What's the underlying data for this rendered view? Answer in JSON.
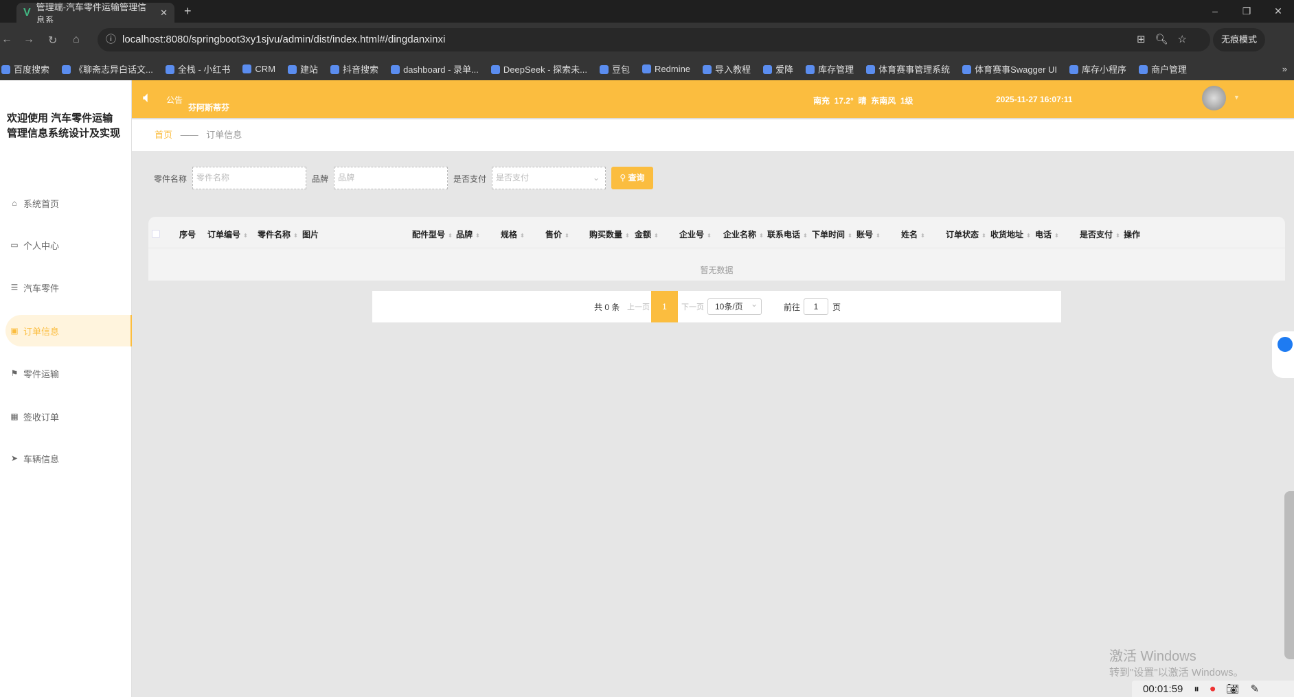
{
  "browser": {
    "tab_title": "管理端-汽车零件运输管理信息系",
    "url": "localhost:8080/springboot3xy1sjvu/admin/dist/index.html#/dingdanxinxi",
    "incognito": "无痕模式",
    "bookmarks": [
      "百度搜索",
      "《聊斋志异白话文...",
      "全栈 - 小红书",
      "CRM",
      "建站",
      "抖音搜索",
      "dashboard - 录单...",
      "DeepSeek - 探索未...",
      "豆包",
      "Redmine",
      "导入教程",
      "爱降",
      "库存管理",
      "体育赛事管理系统",
      "体育赛事Swagger UI",
      "库存小程序",
      "商户管理"
    ]
  },
  "sidebar": {
    "title": "欢迎使用 汽车零件运输管理信息系统设计及实现",
    "items": [
      {
        "label": "系统首页",
        "icon": "home-icon"
      },
      {
        "label": "个人中心",
        "icon": "user-card-icon"
      },
      {
        "label": "汽车零件",
        "icon": "list-icon"
      },
      {
        "label": "订单信息",
        "icon": "clipboard-icon"
      },
      {
        "label": "零件运输",
        "icon": "flag-icon"
      },
      {
        "label": "签收订单",
        "icon": "grid-icon"
      },
      {
        "label": "车辆信息",
        "icon": "send-icon"
      }
    ],
    "active": "订单信息"
  },
  "header": {
    "notice_label": "公告",
    "notice_text": "芬阿斯蒂芬",
    "weather": "南充  17.2°  晴  东南风  1级",
    "datetime": "2025-11-27 16:07:11"
  },
  "breadcrumb": {
    "home": "首页",
    "sep": "——",
    "current": "订单信息"
  },
  "search": {
    "part_name_label": "零件名称",
    "part_name_placeholder": "零件名称",
    "brand_label": "品牌",
    "brand_placeholder": "品牌",
    "paid_label": "是否支付",
    "paid_placeholder": "是否支付",
    "query_button": "查询"
  },
  "table": {
    "columns": [
      {
        "label": "序号",
        "sortable": false
      },
      {
        "label": "订单编号",
        "sortable": true
      },
      {
        "label": "零件名称",
        "sortable": true
      },
      {
        "label": "图片",
        "sortable": false
      },
      {
        "label": "配件型号",
        "sortable": true
      },
      {
        "label": "品牌",
        "sortable": true
      },
      {
        "label": "规格",
        "sortable": true
      },
      {
        "label": "售价",
        "sortable": true
      },
      {
        "label": "购买数量",
        "sortable": true
      },
      {
        "label": "金额",
        "sortable": true
      },
      {
        "label": "企业号",
        "sortable": true
      },
      {
        "label": "企业名称",
        "sortable": true
      },
      {
        "label": "联系电话",
        "sortable": true
      },
      {
        "label": "下单时间",
        "sortable": true
      },
      {
        "label": "账号",
        "sortable": true
      },
      {
        "label": "姓名",
        "sortable": true
      },
      {
        "label": "订单状态",
        "sortable": true
      },
      {
        "label": "收货地址",
        "sortable": true
      },
      {
        "label": "电话",
        "sortable": true
      },
      {
        "label": "是否支付",
        "sortable": true
      },
      {
        "label": "操作",
        "sortable": false
      }
    ],
    "empty_text": "暂无数据"
  },
  "pagination": {
    "total": "共 0 条",
    "prev": "上一页",
    "current": "1",
    "next": "下一页",
    "page_size": "10条/页",
    "goto_label": "前往",
    "goto_value": "1",
    "page_suffix": "页"
  },
  "watermark": {
    "line1": "激活 Windows",
    "line2": "转到\"设置\"以激活 Windows。"
  },
  "recorder": {
    "time": "00:01:59"
  }
}
